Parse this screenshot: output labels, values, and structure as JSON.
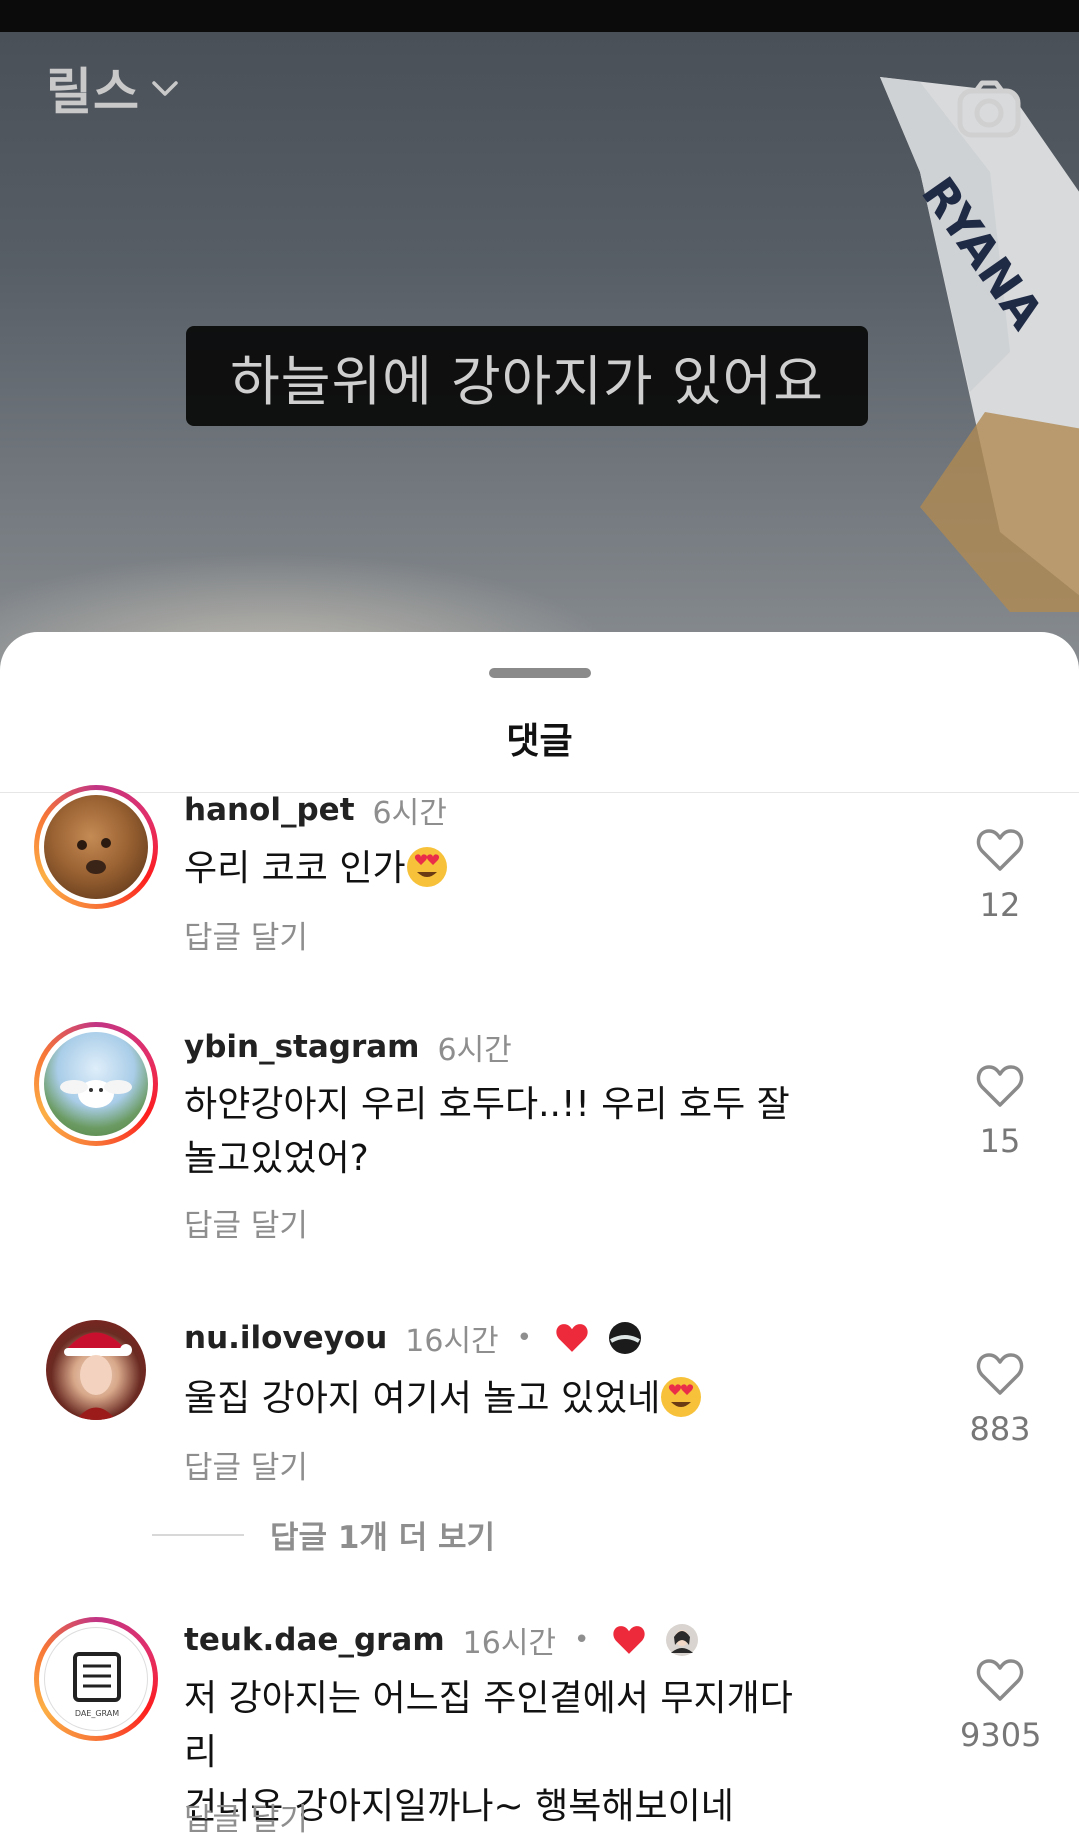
{
  "header": {
    "title": "릴스"
  },
  "video": {
    "caption": "하늘위에 강아지가 있어요"
  },
  "sheet": {
    "title": "댓글"
  },
  "comments": [
    {
      "username": "hanol_pet",
      "time": "6시간",
      "text": "우리 코코 인가",
      "reply_label": "답글 달기",
      "likes": "12"
    },
    {
      "username": "ybin_stagram",
      "time": "6시간",
      "text_line1": "하얀강아지 우리 호두다..!! 우리 호두 잘",
      "text_line2": "놀고있었어?",
      "reply_label": "답글 달기",
      "likes": "15"
    },
    {
      "username": "nu.iloveyou",
      "time": "16시간",
      "separator": "•",
      "text": "울집 강아지 여기서 놀고 있었네",
      "reply_label": "답글 달기",
      "likes": "883",
      "more_replies": "답글 1개 더 보기"
    },
    {
      "username": "teuk.dae_gram",
      "time": "16시간",
      "separator": "•",
      "text_line1": "저 강아지는 어느집 주인곁에서 무지개다리",
      "text_line2": "건너온 강아지일까나~ 행복해보이네",
      "reply_label": "답글 달기",
      "likes": "9305",
      "avatar_logo_text": "DAE_GRAM"
    }
  ],
  "icons": {
    "dropdown": "chevron-down-icon",
    "camera": "camera-icon",
    "like": "heart-outline-icon",
    "creator_like": "heart-filled-icon",
    "emoji": "heart-eyes-emoji"
  },
  "colors": {
    "like_red": "#ed2a3b",
    "muted_text": "#8e8e8e"
  }
}
